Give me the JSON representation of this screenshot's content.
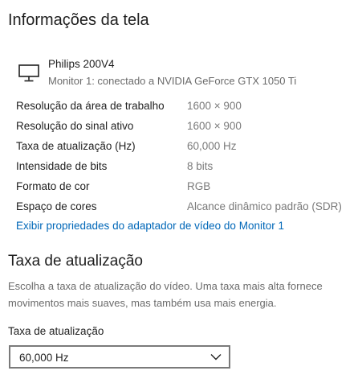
{
  "header": {
    "title": "Informações da tela"
  },
  "monitor": {
    "icon": "monitor-icon",
    "name": "Philips 200V4",
    "connection": "Monitor 1: conectado a NVIDIA GeForce GTX 1050 Ti"
  },
  "info": [
    {
      "label": "Resolução da área de trabalho",
      "value": "1600 × 900"
    },
    {
      "label": "Resolução do sinal ativo",
      "value": "1600 × 900"
    },
    {
      "label": "Taxa de atualização (Hz)",
      "value": "60,000 Hz"
    },
    {
      "label": "Intensidade de bits",
      "value": "8 bits"
    },
    {
      "label": "Formato de cor",
      "value": "RGB"
    },
    {
      "label": "Espaço de cores",
      "value": "Alcance dinâmico padrão (SDR)"
    }
  ],
  "adapter_link": "Exibir propriedades do adaptador de vídeo do Monitor 1",
  "refresh": {
    "title": "Taxa de atualização",
    "description": "Escolha a taxa de atualização do vídeo. Uma taxa mais alta fornece movimentos mais suaves, mas também usa mais energia.",
    "field_label": "Taxa de atualização",
    "selected": "60,000 Hz",
    "dropdown_icon": "chevron-down-icon"
  },
  "colors": {
    "link": "#0067b8",
    "secondary_text": "#6b6b6b",
    "value_text": "#7a7a7a"
  }
}
